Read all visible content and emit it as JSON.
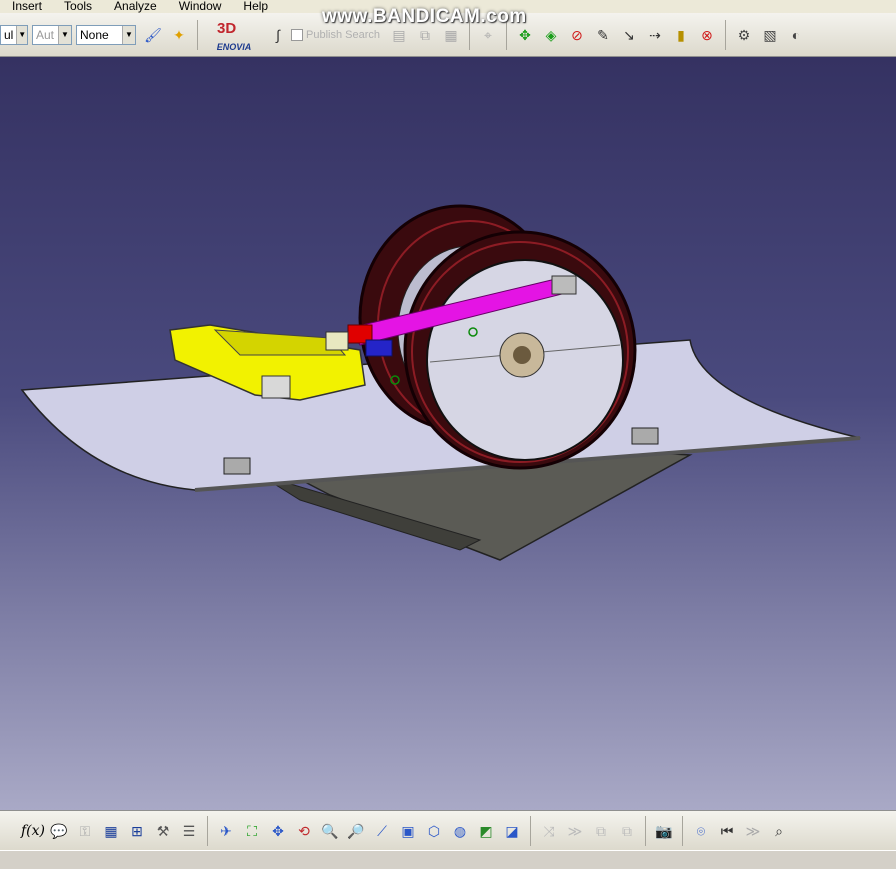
{
  "menu": {
    "insert": "Insert",
    "tools": "Tools",
    "analyze": "Analyze",
    "window": "Window",
    "help": "Help"
  },
  "toolbar": {
    "combo1_value": "ul",
    "combo2_value": "Aut",
    "combo3_value": "None",
    "enovia_label": "ENOVIA",
    "disabled_label": "Publish Search"
  },
  "watermark": "www.BANDICAM.com",
  "colors": {
    "viewport_top": "#353262",
    "viewport_bottom": "#a9a9c6",
    "bracket_yellow": "#f2f200",
    "rod_magenta": "#e414e4",
    "tire_dark_red": "#5c0f16"
  },
  "icons_top": [
    "paint-brush-icon",
    "wand-icon",
    "formula-icon",
    "compass-icon",
    "move-icon",
    "snap-icon",
    "no-entry-icon",
    "pen-icon",
    "line-icon",
    "dimension-icon",
    "ruler-icon",
    "measure-icon",
    "catalog-icon",
    "copy-icon",
    "grid-icon"
  ],
  "icons_bottom": [
    "fx-icon",
    "comment-icon",
    "lock-icon",
    "table-icon",
    "tree-icon",
    "bag-icon",
    "list-icon",
    "fly-icon",
    "fit-all-icon",
    "pan-icon",
    "rotate-icon",
    "zoom-in-icon",
    "zoom-out-icon",
    "normal-view-icon",
    "multi-view-icon",
    "iso-view-icon",
    "render-icon",
    "shading-icon",
    "wireframe-icon",
    "camera-icon",
    "target-icon",
    "rewind-icon",
    "magnifier-icon"
  ]
}
